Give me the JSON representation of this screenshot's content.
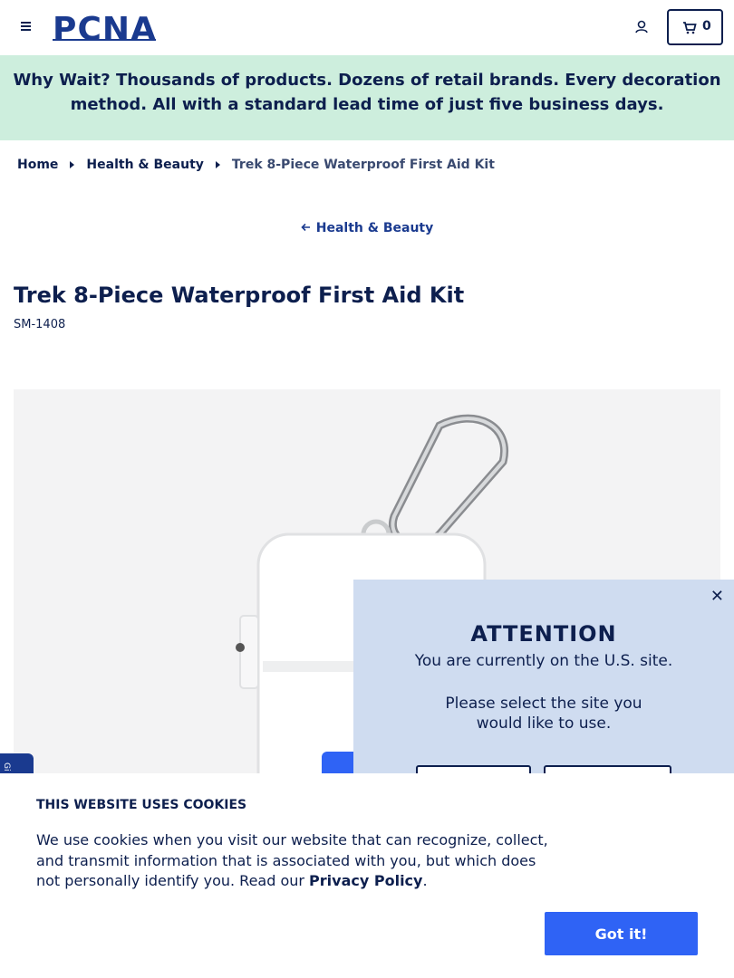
{
  "header": {
    "logo_text": "PCNA",
    "cart_count": "0"
  },
  "promo": {
    "lead": "Why Wait?",
    "message": "Thousands of products. Dozens of retail brands. Every decoration method. All with a standard lead time of just five business days."
  },
  "breadcrumb": {
    "items": [
      "Home",
      "Health & Beauty"
    ],
    "current": "Trek 8-Piece Waterproof First Aid Kit"
  },
  "back_link": {
    "label": "Health & Beauty"
  },
  "product": {
    "title": "Trek 8-Piece Waterproof First Aid Kit",
    "sku": "SM-1408"
  },
  "side_tab": {
    "label": "Gi"
  },
  "attention": {
    "title": "ATTENTION",
    "line1": "You are currently on the U.S. site.",
    "line2": "Please select the site you would like to use."
  },
  "cookie": {
    "title": "THIS WEBSITE USES COOKIES",
    "text": "We use cookies when you visit our website that can recognize, collect, and transmit information that is associated with you, but which does not personally identify you. Read our ",
    "link": "Privacy Policy",
    "period": ".",
    "button": "Got it!"
  }
}
